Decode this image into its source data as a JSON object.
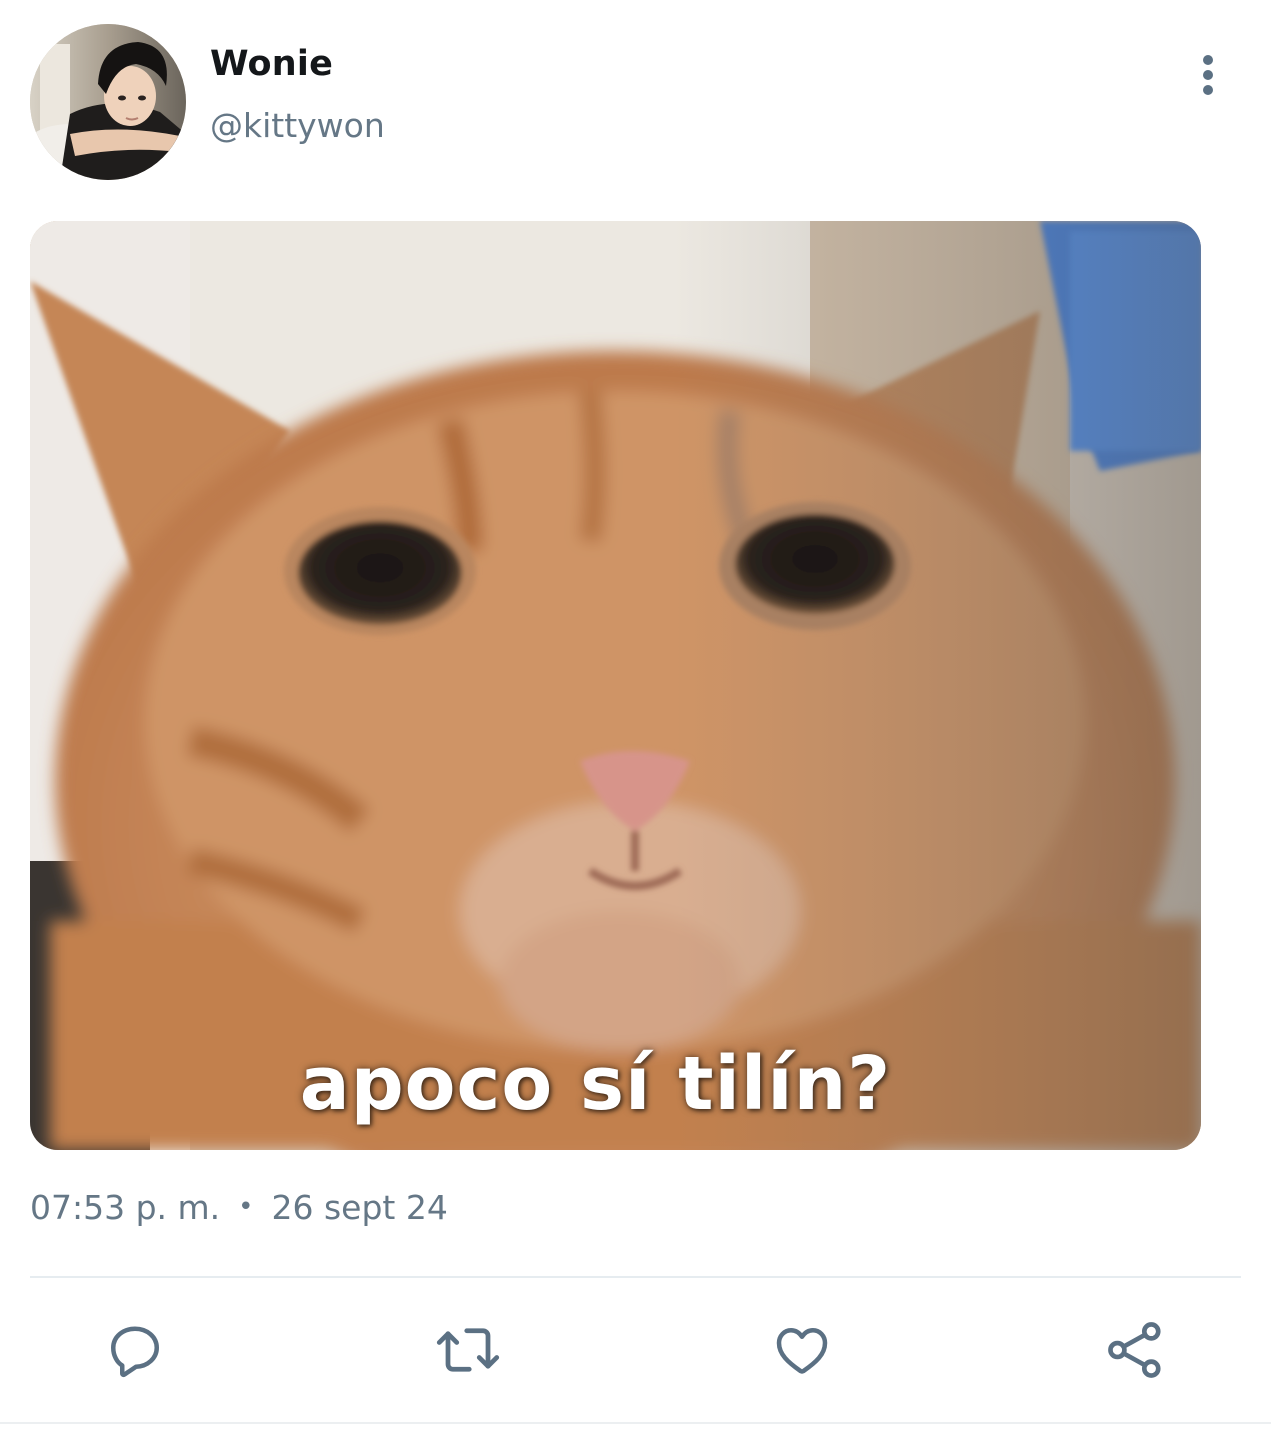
{
  "tweet": {
    "author": {
      "name": "Wonie",
      "handle": "@kittywon"
    },
    "media": {
      "caption": "apoco sí tilín?"
    },
    "meta": {
      "time": "07:53 p. m.",
      "separator": "•",
      "date": "26 sept 24"
    },
    "icons": {
      "more": "more-vertical-icon",
      "reply": "reply-icon",
      "retweet": "retweet-icon",
      "like": "heart-icon",
      "share": "share-icon"
    },
    "colors": {
      "icon": "#5b7083",
      "secondary_text": "#657786",
      "divider": "#e6ecf0"
    }
  }
}
